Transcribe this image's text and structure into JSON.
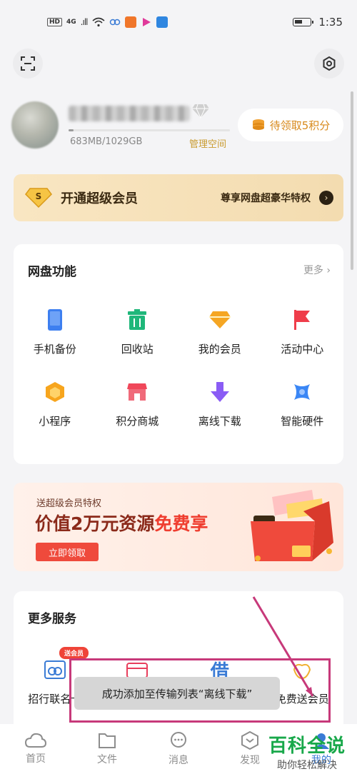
{
  "status_bar": {
    "hd": "HD",
    "network": "4G",
    "signal": ".ıll",
    "time": "1:35"
  },
  "user": {
    "storage_text": "683MB/1029GB",
    "storage_used_fraction": 0.01,
    "manage_label": "管理空间",
    "points_label": "待领取5积分"
  },
  "vip_banner": {
    "title": "开通超级会员",
    "subtitle": "尊享网盘超豪华特权",
    "arrow": "›"
  },
  "features": {
    "title": "网盘功能",
    "more": "更多 ›",
    "items": [
      {
        "label": "手机备份",
        "icon": "phone-icon",
        "color": "#3d7ff0"
      },
      {
        "label": "回收站",
        "icon": "trash-icon",
        "color": "#1fb77a"
      },
      {
        "label": "我的会员",
        "icon": "diamond-icon",
        "color": "#f5a623"
      },
      {
        "label": "活动中心",
        "icon": "flag-icon",
        "color": "#ef3d4a"
      },
      {
        "label": "小程序",
        "icon": "hexagon-icon",
        "color": "#f7a51d"
      },
      {
        "label": "积分商城",
        "icon": "store-icon",
        "color": "#f0475a"
      },
      {
        "label": "离线下载",
        "icon": "download-arrow-icon",
        "color": "#8a5cf5"
      },
      {
        "label": "智能硬件",
        "icon": "smart-hardware-icon",
        "color": "#3a86f5"
      }
    ]
  },
  "promo": {
    "small": "送超级会员特权",
    "big_prefix": "价值2万元资源",
    "big_highlight": "免费享",
    "button": "立即领取"
  },
  "services": {
    "title": "更多服务",
    "badge": "送会员",
    "items": [
      {
        "label": "招行联名卡",
        "icon": "bank-card-icon"
      },
      {
        "label": "",
        "icon": "wallet-icon"
      },
      {
        "label": "借",
        "icon": "loan-icon"
      },
      {
        "label": "免费送会员",
        "icon": "gift-icon"
      }
    ]
  },
  "toast": {
    "text": "成功添加至传输列表“离线下载”"
  },
  "bottom_nav": {
    "items": [
      {
        "label": "首页",
        "icon": "cloud-icon"
      },
      {
        "label": "文件",
        "icon": "folder-icon"
      },
      {
        "label": "消息",
        "icon": "chat-icon"
      },
      {
        "label": "发现",
        "icon": "discover-icon"
      },
      {
        "label": "我的",
        "icon": "profile-icon"
      }
    ]
  },
  "watermark": {
    "top": "百科全说",
    "bottom": "助你轻松解决"
  }
}
